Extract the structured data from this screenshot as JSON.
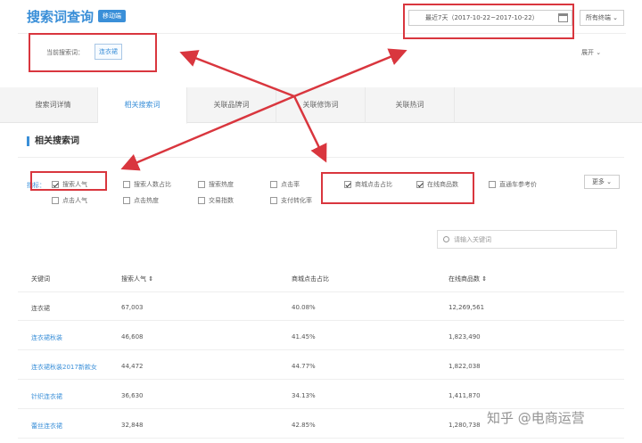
{
  "header": {
    "title": "搜索词查询",
    "badge": "移动端",
    "date_range": "最近7天（2017-10-22~2017-10-22）",
    "terminal": "所有终端",
    "expand": "展开"
  },
  "current": {
    "label": "当前搜索词：",
    "keyword": "连衣裙"
  },
  "tabs": [
    "搜索词详情",
    "相关搜索词",
    "关联品牌词",
    "关联修饰词",
    "关联热词"
  ],
  "section_title": "相关搜索词",
  "filters": {
    "label": "指标：",
    "items": [
      {
        "label": "搜索人气",
        "checked": true
      },
      {
        "label": "搜索人数占比",
        "checked": false
      },
      {
        "label": "搜索热度",
        "checked": false
      },
      {
        "label": "点击率",
        "checked": false
      },
      {
        "label": "商城点击占比",
        "checked": true
      },
      {
        "label": "在线商品数",
        "checked": true
      },
      {
        "label": "直通车参考价",
        "checked": false
      },
      {
        "label": "点击人气",
        "checked": false
      },
      {
        "label": "点击热度",
        "checked": false
      },
      {
        "label": "交易指数",
        "checked": false
      },
      {
        "label": "支付转化率",
        "checked": false
      }
    ],
    "more": "更多"
  },
  "search": {
    "placeholder": "请输入关键词"
  },
  "table": {
    "headers": [
      "关键词",
      "搜索人气 ⇕",
      "商城点击占比",
      "在线商品数 ⇕"
    ],
    "rows": [
      [
        "连衣裙",
        "67,003",
        "40.08%",
        "12,269,561"
      ],
      [
        "连衣裙秋装",
        "46,608",
        "41.45%",
        "1,823,490"
      ],
      [
        "连衣裙秋装2017新款女",
        "44,472",
        "44.77%",
        "1,822,038"
      ],
      [
        "针织连衣裙",
        "36,630",
        "34.13%",
        "1,411,870"
      ],
      [
        "蕾丝连衣裙",
        "32,848",
        "42.85%",
        "1,280,738"
      ]
    ]
  },
  "watermark": "知乎 @电商运营",
  "accent": "#3a8fd8",
  "highlight": "#d9363e"
}
